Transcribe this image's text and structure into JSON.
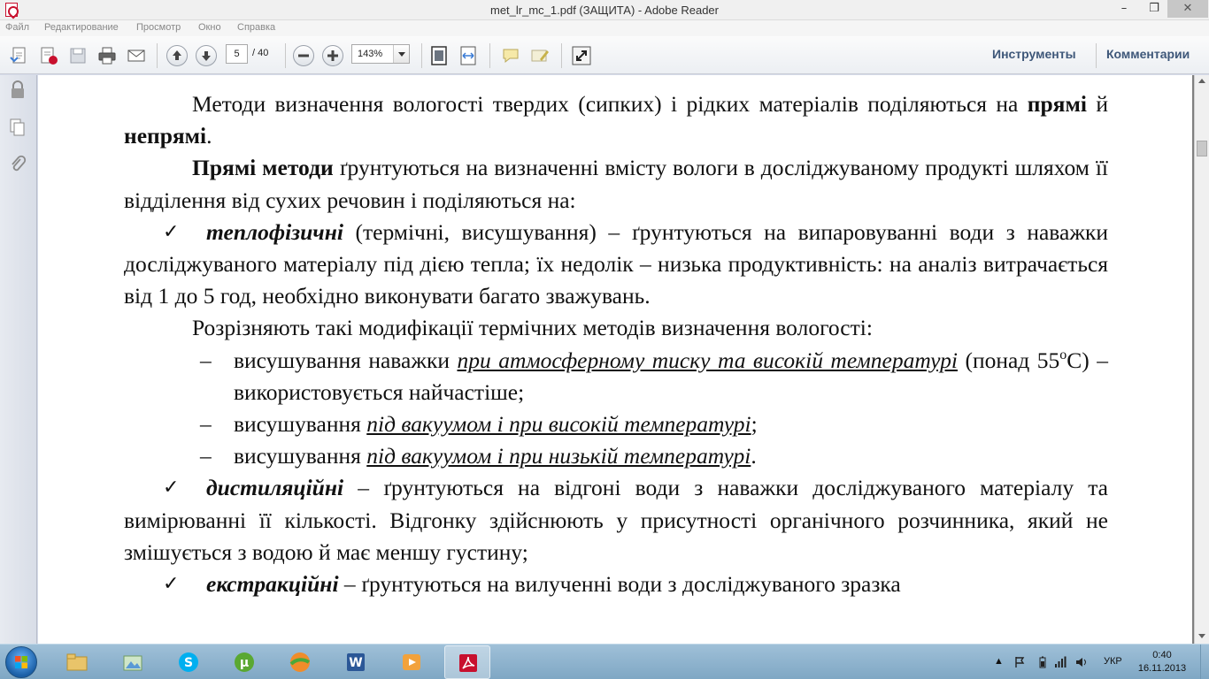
{
  "window": {
    "title": "met_lr_mc_1.pdf (ЗАЩИТА) - Adobe Reader",
    "min": "–",
    "max": "❐",
    "close": "✕"
  },
  "menu": [
    "Файл",
    "Редактирование",
    "Просмотр",
    "Окно",
    "Справка"
  ],
  "toolbar": {
    "page_current": "5",
    "page_total": "/ 40",
    "zoom": "143%",
    "tools_label": "Инструменты",
    "comments_label": "Комментарии"
  },
  "document": {
    "p1_a": "Методи визначення вологості твердих (сипких) і рідких матеріалів поділяються на ",
    "p1_b1": "прямі",
    "p1_c": " й ",
    "p1_b2": "непрямі",
    "p1_d": ".",
    "p2_b": "Прямі методи",
    "p2_rest": " ґрунтуються на визначенні вмісту вологи в досліджуваному продукті шляхом її відділення від сухих речовин і поділяються на:",
    "check_mark": "✓",
    "c1_bi": "теплофізичні",
    "c1_rest": " (термічні, висушування) – ґрунтуються на випаровуванні води з наважки досліджуваного матеріалу під дією тепла; їх недолік – низька продуктивність: на аналіз витрачається від 1 до 5 год, необхідно виконувати багато зважувань.",
    "p3": "Розрізняють такі модифікації термічних методів визначення вологості:",
    "dash_mark": "–",
    "d1_a": "висушування наважки ",
    "d1_u": "при атмосферному тиску та високій температурі",
    "d1_b": " (понад 55",
    "d1_sup": "o",
    "d1_c": "C) – використовується найчастіше;",
    "d2_a": "висушування ",
    "d2_u": "під вакуумом і при високій температурі",
    "d2_b": ";",
    "d3_a": "висушування ",
    "d3_u": "під вакуумом і при низькій температурі",
    "d3_b": ".",
    "c2_bi": "дистиляційні",
    "c2_rest": " – ґрунтуються на відгоні води з наважки досліджуваного матеріалу та вимірюванні її кількості. Відгонку здійснюють у присутності органічного розчинника, який не змішується з водою й має меншу густину;",
    "c3_bi": "екстракційні",
    "c3_rest": " – ґрунтуються на вилученні води з досліджуваного зразка"
  },
  "taskbar": {
    "lang": "УКР",
    "time": "0:40",
    "date": "16.11.2013",
    "tray_arrow": "▲"
  },
  "colors": {
    "accent_link": "#3e5779",
    "adobe_red": "#c8102e",
    "taskbar": "#8fb3cf"
  }
}
